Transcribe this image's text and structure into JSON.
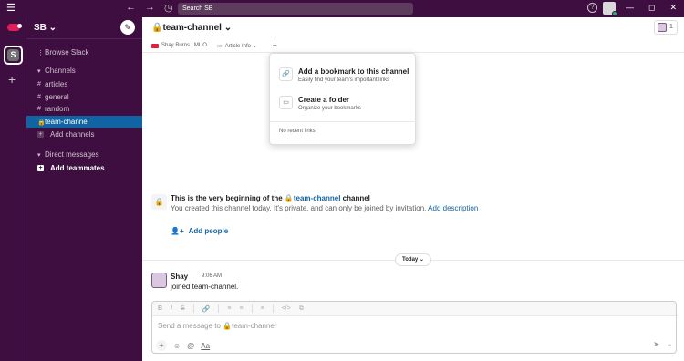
{
  "titlebar": {
    "menu_icon": "☰",
    "back_icon": "←",
    "forward_icon": "→",
    "history_icon": "◷",
    "search_placeholder": "Search SB",
    "help_icon": "?",
    "min_icon": "—",
    "max_icon": "◻",
    "close_icon": "✕"
  },
  "rail": {
    "workspace_initial": "S",
    "add_icon": "+"
  },
  "sidebar": {
    "workspace_name": "SB ⌄",
    "compose_icon": "✎",
    "browse": "Browse Slack",
    "channels_header": "Channels",
    "channels": [
      {
        "label": "articles",
        "icon": "#"
      },
      {
        "label": "general",
        "icon": "#"
      },
      {
        "label": "random",
        "icon": "#"
      },
      {
        "label": "team-channel",
        "icon": "🔒"
      }
    ],
    "add_channels": "Add channels",
    "dm_header": "Direct messages",
    "add_teammates": "Add teammates"
  },
  "channel": {
    "title": "🔒team-channel ⌄",
    "member_count": "1",
    "bookmarks": [
      {
        "label": "Shay Burns | MUO"
      },
      {
        "label": "Article Info ⌄"
      }
    ],
    "bookmark_add": "+"
  },
  "dropdown": {
    "items": [
      {
        "title": "Add a bookmark to this channel",
        "subtitle": "Easily find your team's important links",
        "icon": "🔗"
      },
      {
        "title": "Create a folder",
        "subtitle": "Organize your bookmarks",
        "icon": "▭"
      }
    ],
    "empty": "No recent links"
  },
  "intro": {
    "title_prefix": "This is the very beginning of the ",
    "channel_link": "🔒team-channel",
    "title_suffix": " channel",
    "desc": "You created this channel today. It's private, and can only be joined by invitation. ",
    "desc_link": "Add description",
    "add_people": "Add people"
  },
  "divider": {
    "date": "Today ⌄"
  },
  "message": {
    "author": "Shay",
    "time": "9:06 AM",
    "text": "joined team-channel."
  },
  "composer": {
    "format_icons": [
      "B",
      "I",
      "S",
      "🔗",
      "≡",
      "≡",
      "≡",
      "</>",
      "⧉"
    ],
    "placeholder": "Send a message to 🔒team-channel",
    "tools": [
      "+",
      "☺",
      "@",
      "Aa"
    ],
    "send_icon": "➤",
    "send_chevron": "⌄"
  }
}
